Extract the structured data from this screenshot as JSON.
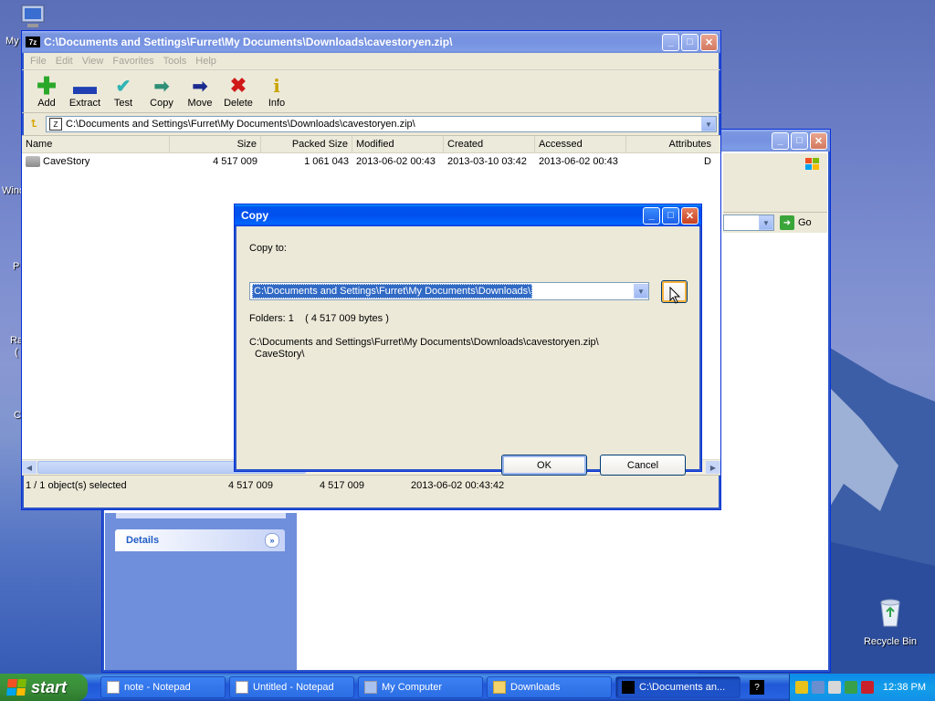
{
  "desktop": {
    "icons": [
      {
        "label": "My",
        "name": "my-computer-desktop-icon"
      },
      {
        "label": "Recycle Bin",
        "name": "recycle-bin-desktop-icon"
      }
    ],
    "left_fragments": [
      "Wind",
      "P",
      "Ra",
      "(",
      "C"
    ]
  },
  "zip_window": {
    "title": "C:\\Documents and Settings\\Furret\\My Documents\\Downloads\\cavestoryen.zip\\",
    "menu": [
      "File",
      "Edit",
      "View",
      "Favorites",
      "Tools",
      "Help"
    ],
    "toolbar": [
      {
        "label": "Add",
        "icon": "add-icon"
      },
      {
        "label": "Extract",
        "icon": "extract-icon"
      },
      {
        "label": "Test",
        "icon": "test-icon"
      },
      {
        "label": "Copy",
        "icon": "copy-icon"
      },
      {
        "label": "Move",
        "icon": "move-icon"
      },
      {
        "label": "Delete",
        "icon": "delete-icon"
      },
      {
        "label": "Info",
        "icon": "info-icon"
      }
    ],
    "address": "C:\\Documents and Settings\\Furret\\My Documents\\Downloads\\cavestoryen.zip\\",
    "columns": [
      "Name",
      "Size",
      "Packed Size",
      "Modified",
      "Created",
      "Accessed",
      "Attributes"
    ],
    "rows": [
      {
        "name": "CaveStory",
        "size": "4 517 009",
        "packed": "1 061 043",
        "modified": "2013-06-02 00:43",
        "created": "2013-03-10 03:42",
        "accessed": "2013-06-02 00:43",
        "attributes": "D"
      }
    ],
    "status": {
      "selected": "1 / 1 object(s) selected",
      "size": "4 517 009",
      "packed": "4 517 009",
      "date": "2013-06-02 00:43:42"
    }
  },
  "explorer_window": {
    "go_label": "Go",
    "details_label": "Details"
  },
  "copy_dialog": {
    "title": "Copy",
    "copy_to_label": "Copy to:",
    "destination": "C:\\Documents and Settings\\Furret\\My Documents\\Downloads\\",
    "browse_label": "...",
    "folders_info": "Folders: 1    ( 4 517 009 bytes )",
    "source_line1": "C:\\Documents and Settings\\Furret\\My Documents\\Downloads\\cavestoryen.zip\\",
    "source_line2": "CaveStory\\",
    "ok_label": "OK",
    "cancel_label": "Cancel"
  },
  "taskbar": {
    "start_label": "start",
    "tasks": [
      {
        "label": "note - Notepad",
        "active": false
      },
      {
        "label": "Untitled - Notepad",
        "active": false
      },
      {
        "label": "My Computer",
        "active": false
      },
      {
        "label": "Downloads",
        "active": false
      },
      {
        "label": "C:\\Documents an...",
        "active": true
      }
    ],
    "clock": "12:38 PM"
  }
}
